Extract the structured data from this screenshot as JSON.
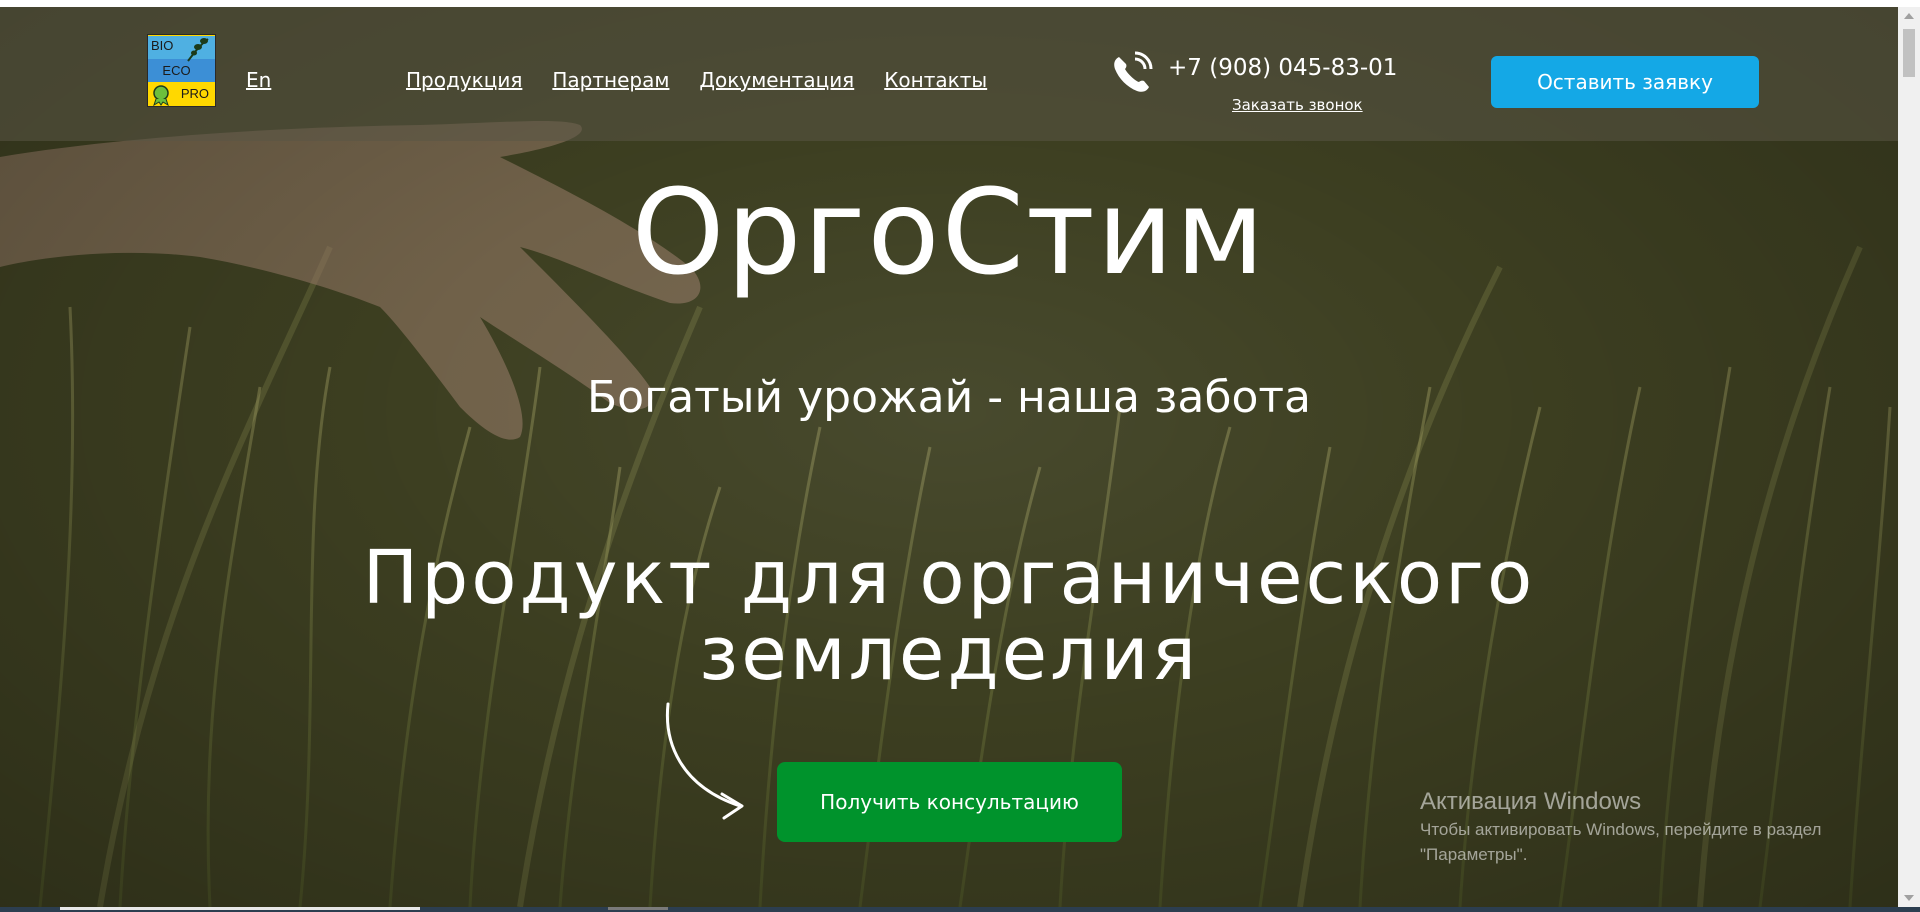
{
  "logo": {
    "lines": [
      "BIO",
      "ECO",
      "PRO"
    ]
  },
  "header": {
    "lang": "En",
    "nav": [
      {
        "label": "Продукция"
      },
      {
        "label": "Партнерам"
      },
      {
        "label": "Документация"
      },
      {
        "label": "Контакты"
      }
    ],
    "phone": "+7 (908) 045-83-01",
    "callback": "Заказать звонок",
    "request_button": "Оставить заявку"
  },
  "hero": {
    "title": "ОргоСтим",
    "subtitle": "Богатый урожай - наша забота",
    "headline_line1": "Продукт для органического",
    "headline_line2": "земледелия",
    "consult_button": "Получить консультацию"
  },
  "windows_activation": {
    "heading": "Активация Windows",
    "line1": "Чтобы активировать Windows, перейдите в раздел",
    "line2": "\"Параметры\"."
  },
  "colors": {
    "request_button": "#14a8e6",
    "consult_button": "#00932c"
  }
}
